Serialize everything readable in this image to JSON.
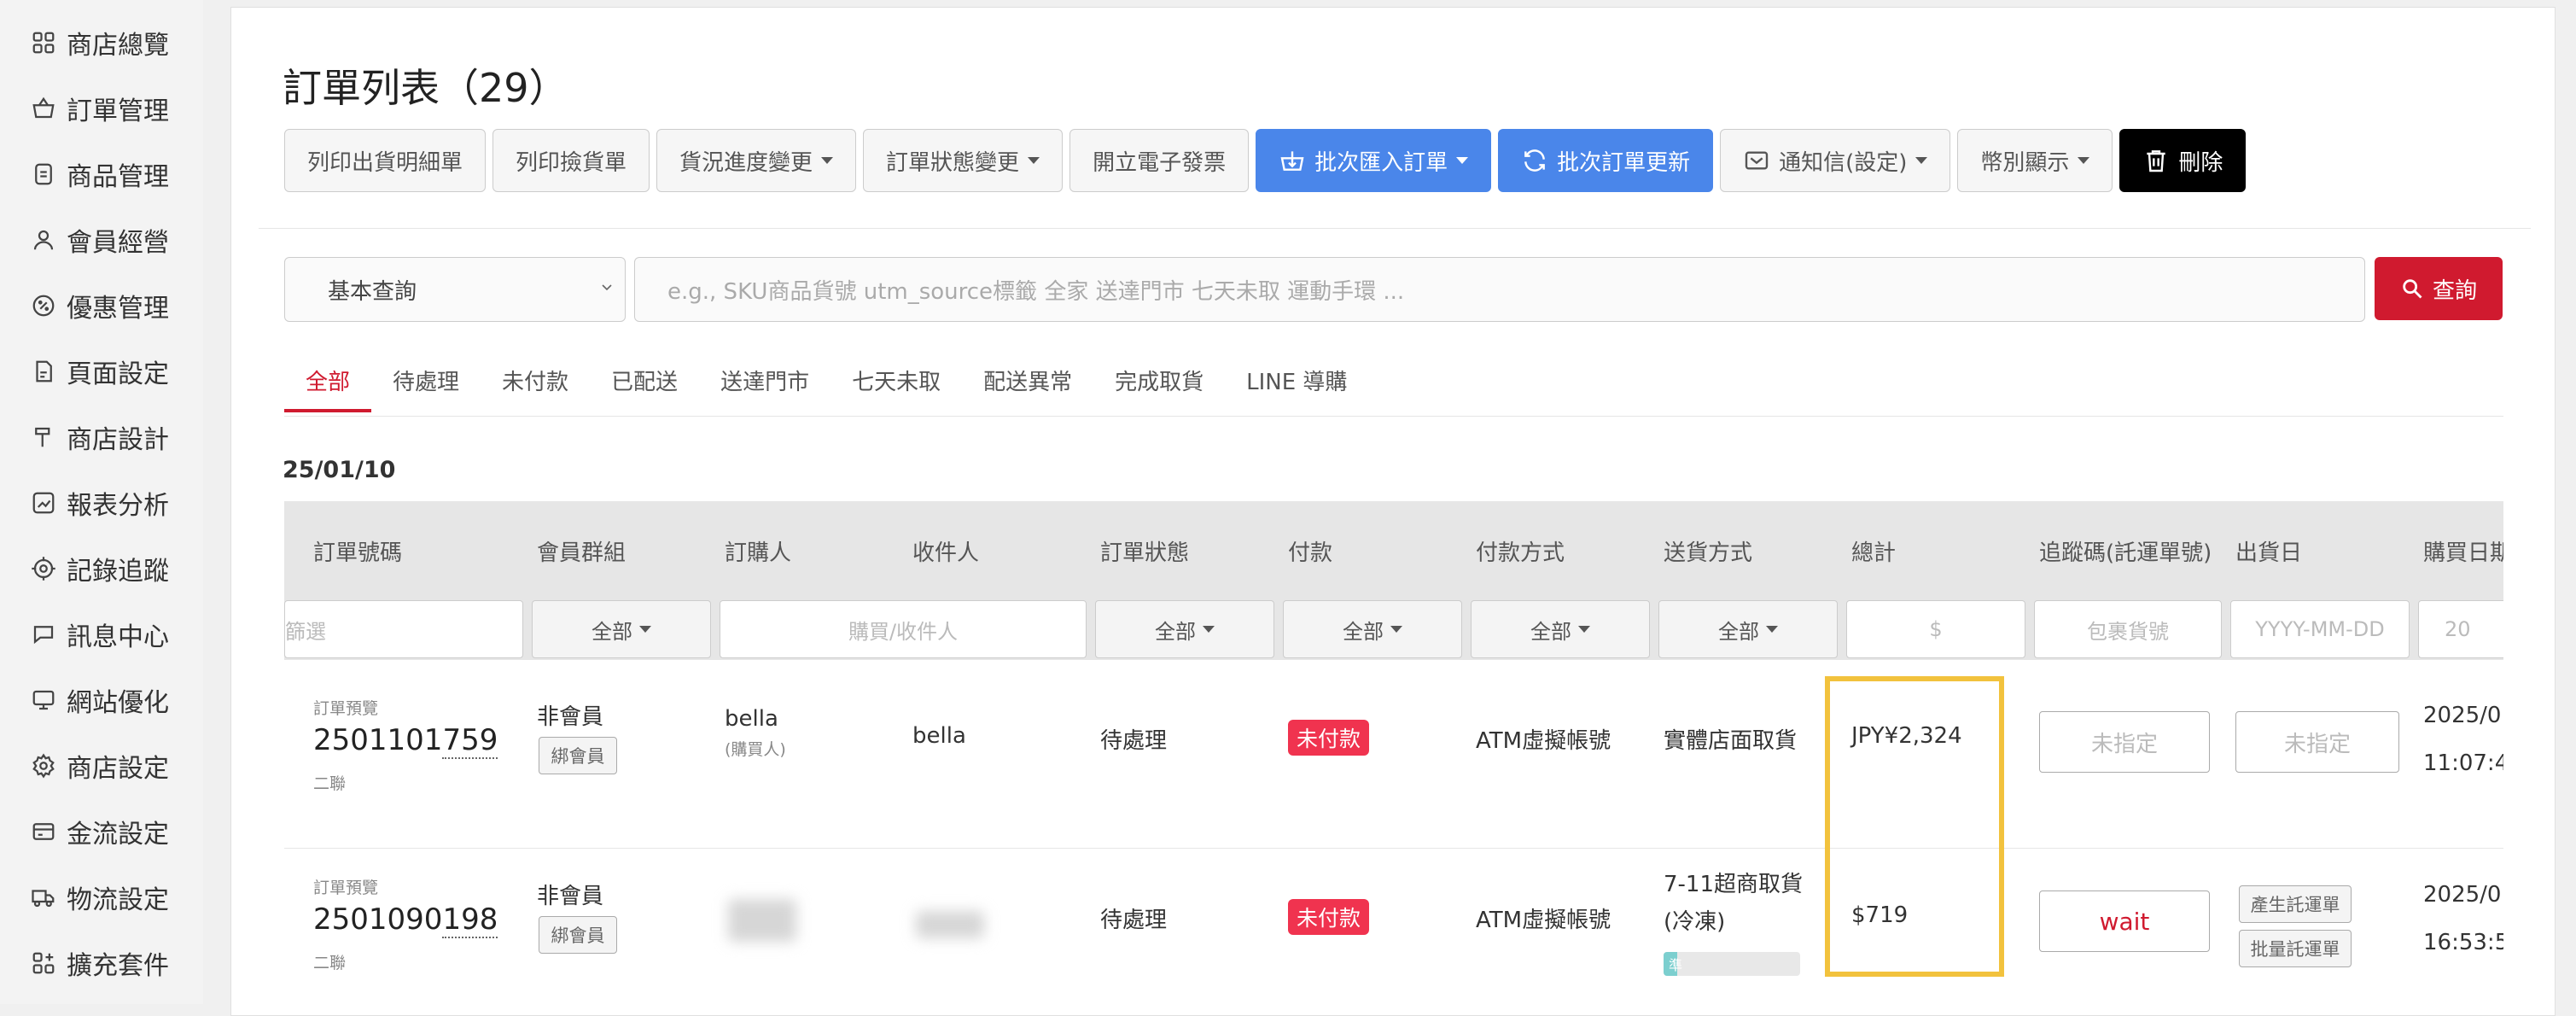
{
  "sidebar": {
    "items": [
      {
        "label": "商店總覽",
        "icon": "grid-icon"
      },
      {
        "label": "訂單管理",
        "icon": "basket-icon"
      },
      {
        "label": "商品管理",
        "icon": "tag-icon"
      },
      {
        "label": "會員經營",
        "icon": "user-icon"
      },
      {
        "label": "優惠管理",
        "icon": "discount-icon"
      },
      {
        "label": "頁面設定",
        "icon": "file-icon"
      },
      {
        "label": "商店設計",
        "icon": "brush-icon"
      },
      {
        "label": "報表分析",
        "icon": "chart-icon"
      },
      {
        "label": "記錄追蹤",
        "icon": "target-icon"
      },
      {
        "label": "訊息中心",
        "icon": "message-icon"
      },
      {
        "label": "網站優化",
        "icon": "monitor-icon"
      },
      {
        "label": "商店設定",
        "icon": "gear-icon"
      },
      {
        "label": "金流設定",
        "icon": "card-icon"
      },
      {
        "label": "物流設定",
        "icon": "truck-icon"
      },
      {
        "label": "擴充套件",
        "icon": "plugin-icon"
      }
    ]
  },
  "page": {
    "title": "訂單列表（29）"
  },
  "toolbar": {
    "print_detail": "列印出貨明細單",
    "print_pick": "列印撿貨單",
    "shipping_progress": "貨況進度變更",
    "order_status": "訂單狀態變更",
    "invoice": "開立電子發票",
    "batch_import": "批次匯入訂單",
    "batch_update": "批次訂單更新",
    "notify": "通知信(設定)",
    "currency": "幣別顯示",
    "delete": "刪除"
  },
  "search": {
    "mode": "基本查詢",
    "placeholder": "e.g.,  SKU商品貨號   utm_source標籤   全家   送達門市   七天未取   運動手環  ...",
    "button": "查詢"
  },
  "tabs": [
    "全部",
    "待處理",
    "未付款",
    "已配送",
    "送達門市",
    "七天未取",
    "配送異常",
    "完成取貨",
    "LINE 導購"
  ],
  "active_tab": "全部",
  "date_group": "25/01/10",
  "table": {
    "headers": {
      "order_no": "訂單號碼",
      "member_group": "會員群組",
      "buyer": "訂購人",
      "recipient": "收件人",
      "status": "訂單狀態",
      "payment": "付款",
      "pay_method": "付款方式",
      "ship_method": "送貨方式",
      "total": "總計",
      "tracking": "追蹤碼(託運單號)",
      "ship_date": "出貨日",
      "purchase_date": "購買日期"
    },
    "filters": {
      "order_no": "篩選",
      "member_group": "全部",
      "buyer": "購買/收件人",
      "status": "全部",
      "payment": "全部",
      "pay_method": "全部",
      "ship_method": "全部",
      "total": "$",
      "tracking": "包裹貨號",
      "ship_date": "YYYY-MM-DD",
      "purchase_date": "20"
    },
    "rows": [
      {
        "preview": "訂單預覽",
        "order_no_head": "2501101",
        "order_no_tail": "759",
        "sub": "二聯",
        "member": "非會員",
        "bind": "綁會員",
        "buyer": "bella",
        "buyer_sub": "(購買人)",
        "recipient": "bella",
        "status": "待處理",
        "payment": "未付款",
        "pay_method": "ATM虛擬帳號",
        "ship_method": "實體店面取貨",
        "total": "JPY¥2,324",
        "tracking": "未指定",
        "ship_date": "未指定",
        "date": "2025/0",
        "time": "11:07:4"
      },
      {
        "preview": "訂單預覽",
        "order_no_head": "2501090",
        "order_no_tail": "198",
        "sub": "二聯",
        "member": "非會員",
        "bind": "綁會員",
        "status": "待處理",
        "payment": "未付款",
        "pay_method": "ATM虛擬帳號",
        "ship_method_1": "7-11超商取貨",
        "ship_method_2": "(冷凍)",
        "ship_progress_label": "準",
        "ship_progress": 0.1,
        "total": "$719",
        "tracking": "wait",
        "gen_waybill": "產生託運單",
        "batch_waybill": "批量託運單",
        "date": "2025/0",
        "time": "16:53:5"
      }
    ]
  },
  "colors": {
    "accent_red": "#d01a2f",
    "primary_blue": "#4a86ea",
    "badge_red": "#f0334f",
    "highlight_yellow": "#f2c23d"
  }
}
